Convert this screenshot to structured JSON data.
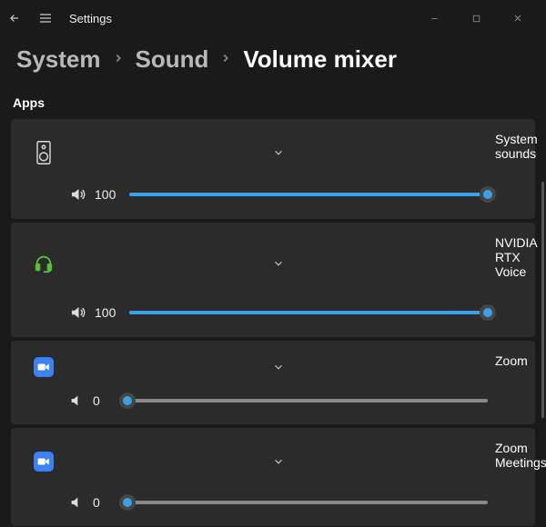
{
  "title": "Settings",
  "breadcrumb": {
    "l1": "System",
    "l2": "Sound",
    "current": "Volume mixer"
  },
  "section": "Apps",
  "apps": [
    {
      "name": "System sounds",
      "volume": 100,
      "icon": "speaker-device",
      "muted": false
    },
    {
      "name": "NVIDIA RTX Voice",
      "volume": 100,
      "icon": "headset-green",
      "muted": false
    },
    {
      "name": "Zoom",
      "volume": 0,
      "icon": "zoom",
      "muted": true
    },
    {
      "name": "Zoom Meetings",
      "volume": 0,
      "icon": "zoom",
      "muted": true
    }
  ],
  "colors": {
    "accent": "#3aa0e9",
    "card": "#2b2b2b",
    "bg": "#1a1a1a"
  }
}
